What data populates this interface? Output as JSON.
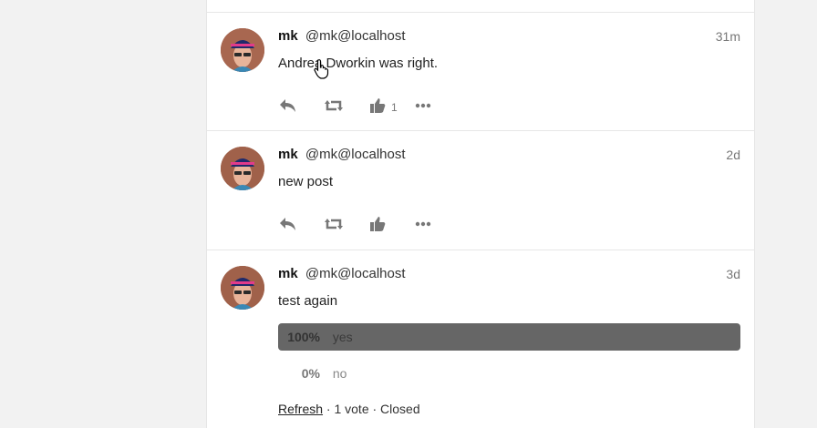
{
  "posts": [
    {
      "name": "mk",
      "handle": "@mk@localhost",
      "time": "31m",
      "content": "Andrea Dworkin was right.",
      "favourites": "1"
    },
    {
      "name": "mk",
      "handle": "@mk@localhost",
      "time": "2d",
      "content": "new post",
      "favourites": ""
    },
    {
      "name": "mk",
      "handle": "@mk@localhost",
      "time": "3d",
      "content": "test again",
      "poll": {
        "options": [
          {
            "percent": "100%",
            "label": "yes"
          },
          {
            "percent": "0%",
            "label": "no"
          }
        ],
        "refresh": "Refresh",
        "summary": " · 1 vote · Closed"
      }
    }
  ],
  "colors": {
    "background": "#f2f2f2",
    "card": "#ffffff",
    "poll_leading_bar": "#666666",
    "icon": "#777777"
  },
  "icons": [
    "reply-icon",
    "boost-icon",
    "favourite-icon",
    "more-icon"
  ]
}
